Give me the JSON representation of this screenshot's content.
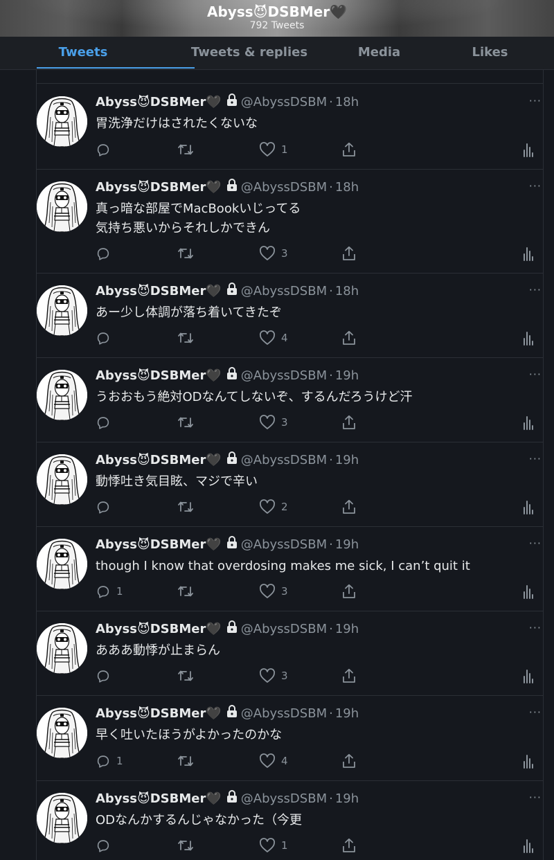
{
  "header": {
    "name": "Abyss😈DSBMer🖤",
    "tweet_count": "792 Tweets"
  },
  "tabs": [
    {
      "label": "Tweets",
      "active": true
    },
    {
      "label": "Tweets & replies",
      "active": false
    },
    {
      "label": "Media",
      "active": false
    },
    {
      "label": "Likes",
      "active": false
    }
  ],
  "colors": {
    "accent": "#4aa0ea",
    "background": "#15181e",
    "muted": "#8b939b"
  },
  "tweets": [
    {
      "name": "Abyss😈DSBMer🖤",
      "handle": "@AbyssDSBM",
      "time": "18h",
      "text": "胃洗浄だけはされたくないな",
      "replies": "",
      "likes": "1"
    },
    {
      "name": "Abyss😈DSBMer🖤",
      "handle": "@AbyssDSBM",
      "time": "18h",
      "text": "真っ暗な部屋でMacBookいじってる\n気持ち悪いからそれしかできん",
      "replies": "",
      "likes": "3"
    },
    {
      "name": "Abyss😈DSBMer🖤",
      "handle": "@AbyssDSBM",
      "time": "18h",
      "text": "あー少し体調が落ち着いてきたぞ",
      "replies": "",
      "likes": "4"
    },
    {
      "name": "Abyss😈DSBMer🖤",
      "handle": "@AbyssDSBM",
      "time": "19h",
      "text": "うおおもう絶対ODなんてしないぞ、するんだろうけど汗",
      "replies": "",
      "likes": "3"
    },
    {
      "name": "Abyss😈DSBMer🖤",
      "handle": "@AbyssDSBM",
      "time": "19h",
      "text": "動悸吐き気目眩、マジで辛い",
      "replies": "",
      "likes": "2"
    },
    {
      "name": "Abyss😈DSBMer🖤",
      "handle": "@AbyssDSBM",
      "time": "19h",
      "text": "though I know that overdosing makes me sick, I can’t quit it",
      "replies": "1",
      "likes": "3"
    },
    {
      "name": "Abyss😈DSBMer🖤",
      "handle": "@AbyssDSBM",
      "time": "19h",
      "text": "あああ動悸が止まらん",
      "replies": "",
      "likes": "3"
    },
    {
      "name": "Abyss😈DSBMer🖤",
      "handle": "@AbyssDSBM",
      "time": "19h",
      "text": "早く吐いたほうがよかったのかな",
      "replies": "1",
      "likes": "4"
    },
    {
      "name": "Abyss😈DSBMer🖤",
      "handle": "@AbyssDSBM",
      "time": "19h",
      "text": "ODなんかするんじゃなかった（今更",
      "replies": "",
      "likes": "1"
    }
  ],
  "icons": {
    "lock": "lock-icon",
    "reply": "reply-icon",
    "retweet": "retweet-icon",
    "like": "heart-icon",
    "share": "share-icon",
    "stats": "stats-icon",
    "more": "more-icon"
  },
  "more_glyph": "···"
}
